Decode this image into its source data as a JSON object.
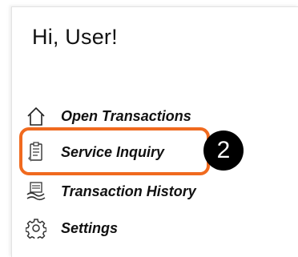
{
  "greeting": "Hi, User!",
  "nav": {
    "items": [
      {
        "label": "Open Transactions",
        "icon": "home-icon"
      },
      {
        "label": "Service Inquiry",
        "icon": "clipboard-icon"
      },
      {
        "label": "Transaction History",
        "icon": "history-icon"
      },
      {
        "label": "Settings",
        "icon": "gear-icon"
      }
    ]
  },
  "callout": {
    "step_number": "2",
    "highlight_color": "#f06a1f"
  }
}
